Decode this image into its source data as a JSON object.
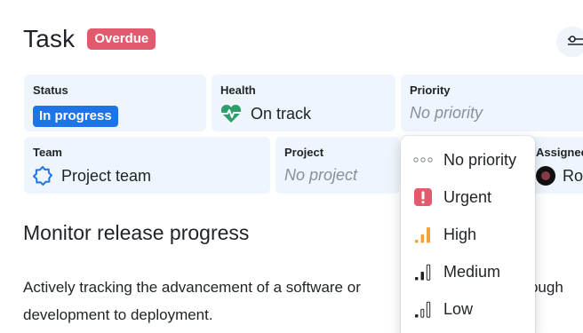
{
  "header": {
    "title": "Task",
    "status_badge": "Overdue"
  },
  "fields": {
    "status": {
      "label": "Status",
      "value": "In progress"
    },
    "health": {
      "label": "Health",
      "value": "On track"
    },
    "priority": {
      "label": "Priority",
      "value": "No priority"
    },
    "team": {
      "label": "Team",
      "value": "Project team"
    },
    "project": {
      "label": "Project",
      "value": "No project"
    },
    "assignee": {
      "label": "Assignee",
      "value": "Ro"
    }
  },
  "description": {
    "title": "Monitor release progress",
    "text_line1": "Actively tracking the advancement of a software or",
    "text_line1_end": "hrough",
    "text_line2": "development to deployment."
  },
  "priority_menu": {
    "items": [
      {
        "label": "No priority",
        "icon": "dots-icon"
      },
      {
        "label": "Urgent",
        "icon": "urgent-icon"
      },
      {
        "label": "High",
        "icon": "signal-high-icon"
      },
      {
        "label": "Medium",
        "icon": "signal-medium-icon"
      },
      {
        "label": "Low",
        "icon": "signal-low-icon"
      }
    ]
  },
  "colors": {
    "overdue": "#e15a6d",
    "in_progress": "#1d74e8",
    "health_green": "#2e9e6a",
    "urgent": "#e15a6d",
    "high": "#f0a33a",
    "field_bg": "#eef5fc"
  }
}
